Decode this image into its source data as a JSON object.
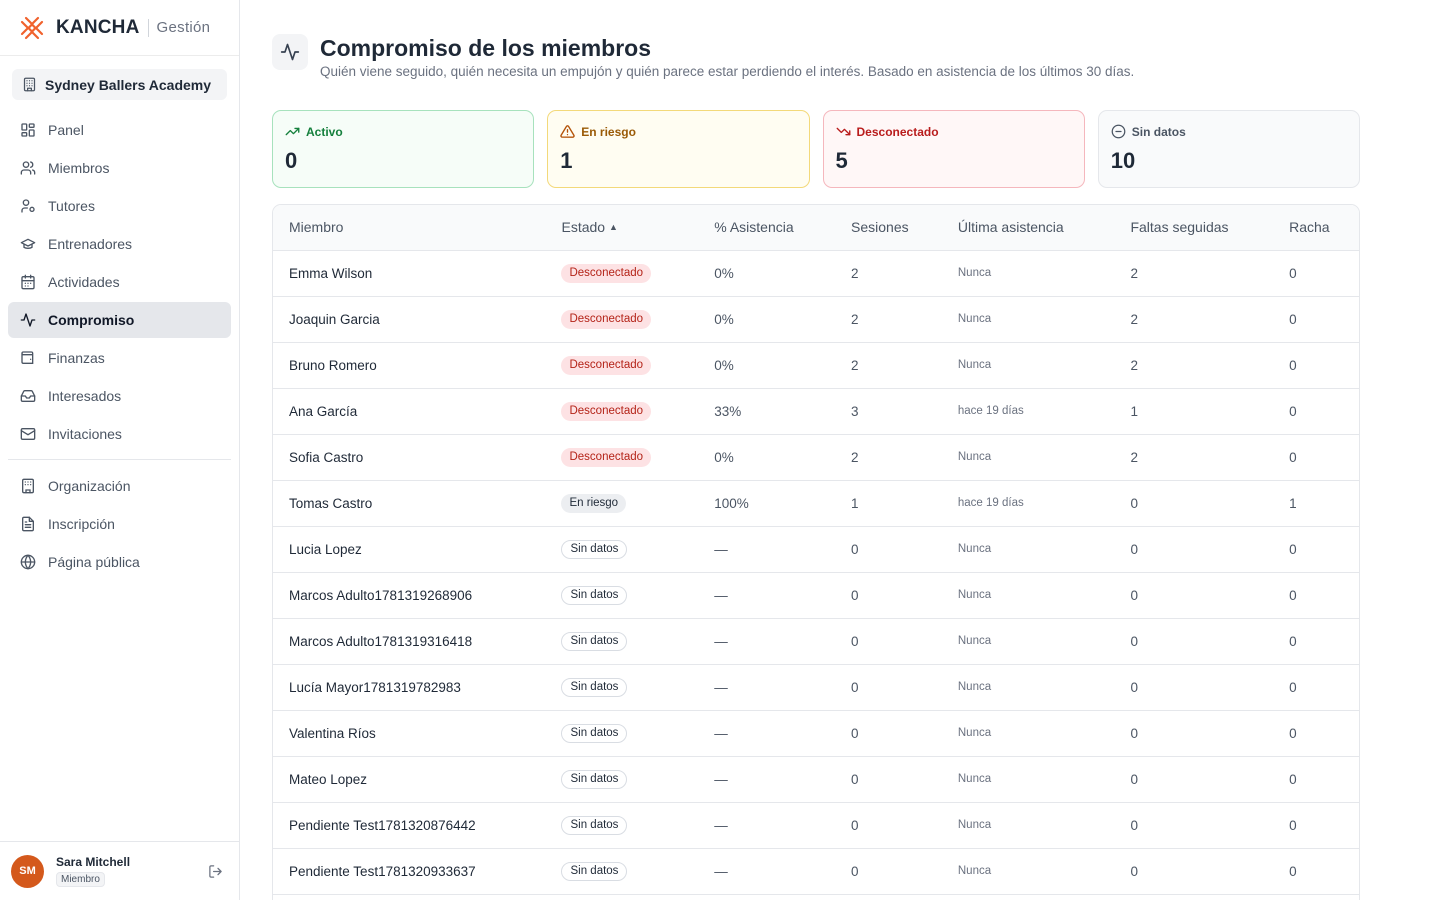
{
  "brand": {
    "name": "KANCHA",
    "sub": "Gestión"
  },
  "org": {
    "label": "Sydney Ballers Academy"
  },
  "nav": {
    "panel": "Panel",
    "miembros": "Miembros",
    "tutores": "Tutores",
    "entrenadores": "Entrenadores",
    "actividades": "Actividades",
    "compromiso": "Compromiso",
    "finanzas": "Finanzas",
    "interesados": "Interesados",
    "invitaciones": "Invitaciones",
    "organizacion": "Organización",
    "inscripcion": "Inscripción",
    "pagina_publica": "Página pública"
  },
  "user": {
    "initials": "SM",
    "name": "Sara Mitchell",
    "role": "Miembro"
  },
  "header": {
    "title": "Compromiso de los miembros",
    "subtitle": "Quién viene seguido, quién necesita un empujón y quién parece estar perdiendo el interés. Basado en asistencia de los últimos 30 días."
  },
  "cards": [
    {
      "label": "Activo",
      "value": "0",
      "color": "#15803d"
    },
    {
      "label": "En riesgo",
      "value": "1",
      "color": "#9a5a06"
    },
    {
      "label": "Desconectado",
      "value": "5",
      "color": "#b91c1c"
    },
    {
      "label": "Sin datos",
      "value": "10",
      "color": "#4b5563"
    }
  ],
  "table": {
    "headers": {
      "miembro": "Miembro",
      "estado": "Estado",
      "sort_arrow": "▲",
      "asistencia": "% Asistencia",
      "sesiones": "Sesiones",
      "ultima": "Última asistencia",
      "faltas": "Faltas seguidas",
      "racha": "Racha"
    },
    "rows": [
      {
        "name": "Emma Wilson",
        "status": "Desconectado",
        "attendance": "0%",
        "sessions": "2",
        "last": "Nunca",
        "misses": "2",
        "streak": "0"
      },
      {
        "name": "Joaquin Garcia",
        "status": "Desconectado",
        "attendance": "0%",
        "sessions": "2",
        "last": "Nunca",
        "misses": "2",
        "streak": "0"
      },
      {
        "name": "Bruno Romero",
        "status": "Desconectado",
        "attendance": "0%",
        "sessions": "2",
        "last": "Nunca",
        "misses": "2",
        "streak": "0"
      },
      {
        "name": "Ana García",
        "status": "Desconectado",
        "attendance": "33%",
        "sessions": "3",
        "last": "hace 19 días",
        "misses": "1",
        "streak": "0"
      },
      {
        "name": "Sofia Castro",
        "status": "Desconectado",
        "attendance": "0%",
        "sessions": "2",
        "last": "Nunca",
        "misses": "2",
        "streak": "0"
      },
      {
        "name": "Tomas Castro",
        "status": "En riesgo",
        "attendance": "100%",
        "sessions": "1",
        "last": "hace 19 días",
        "misses": "0",
        "streak": "1"
      },
      {
        "name": "Lucia Lopez",
        "status": "Sin datos",
        "attendance": "—",
        "sessions": "0",
        "last": "Nunca",
        "misses": "0",
        "streak": "0"
      },
      {
        "name": "Marcos Adulto1781319268906",
        "status": "Sin datos",
        "attendance": "—",
        "sessions": "0",
        "last": "Nunca",
        "misses": "0",
        "streak": "0"
      },
      {
        "name": "Marcos Adulto1781319316418",
        "status": "Sin datos",
        "attendance": "—",
        "sessions": "0",
        "last": "Nunca",
        "misses": "0",
        "streak": "0"
      },
      {
        "name": "Lucía Mayor1781319782983",
        "status": "Sin datos",
        "attendance": "—",
        "sessions": "0",
        "last": "Nunca",
        "misses": "0",
        "streak": "0"
      },
      {
        "name": "Valentina Ríos",
        "status": "Sin datos",
        "attendance": "—",
        "sessions": "0",
        "last": "Nunca",
        "misses": "0",
        "streak": "0"
      },
      {
        "name": "Mateo Lopez",
        "status": "Sin datos",
        "attendance": "—",
        "sessions": "0",
        "last": "Nunca",
        "misses": "0",
        "streak": "0"
      },
      {
        "name": "Pendiente Test1781320876442",
        "status": "Sin datos",
        "attendance": "—",
        "sessions": "0",
        "last": "Nunca",
        "misses": "0",
        "streak": "0"
      },
      {
        "name": "Pendiente Test1781320933637",
        "status": "Sin datos",
        "attendance": "—",
        "sessions": "0",
        "last": "Nunca",
        "misses": "0",
        "streak": "0"
      },
      {
        "name": "",
        "status": "",
        "attendance": "",
        "sessions": "",
        "last": "",
        "misses": "",
        "streak": ""
      }
    ]
  },
  "colors": {
    "brand_accent": "#f0622d",
    "avatar": "#d4591c",
    "active_nav": "#e5e7eb"
  }
}
